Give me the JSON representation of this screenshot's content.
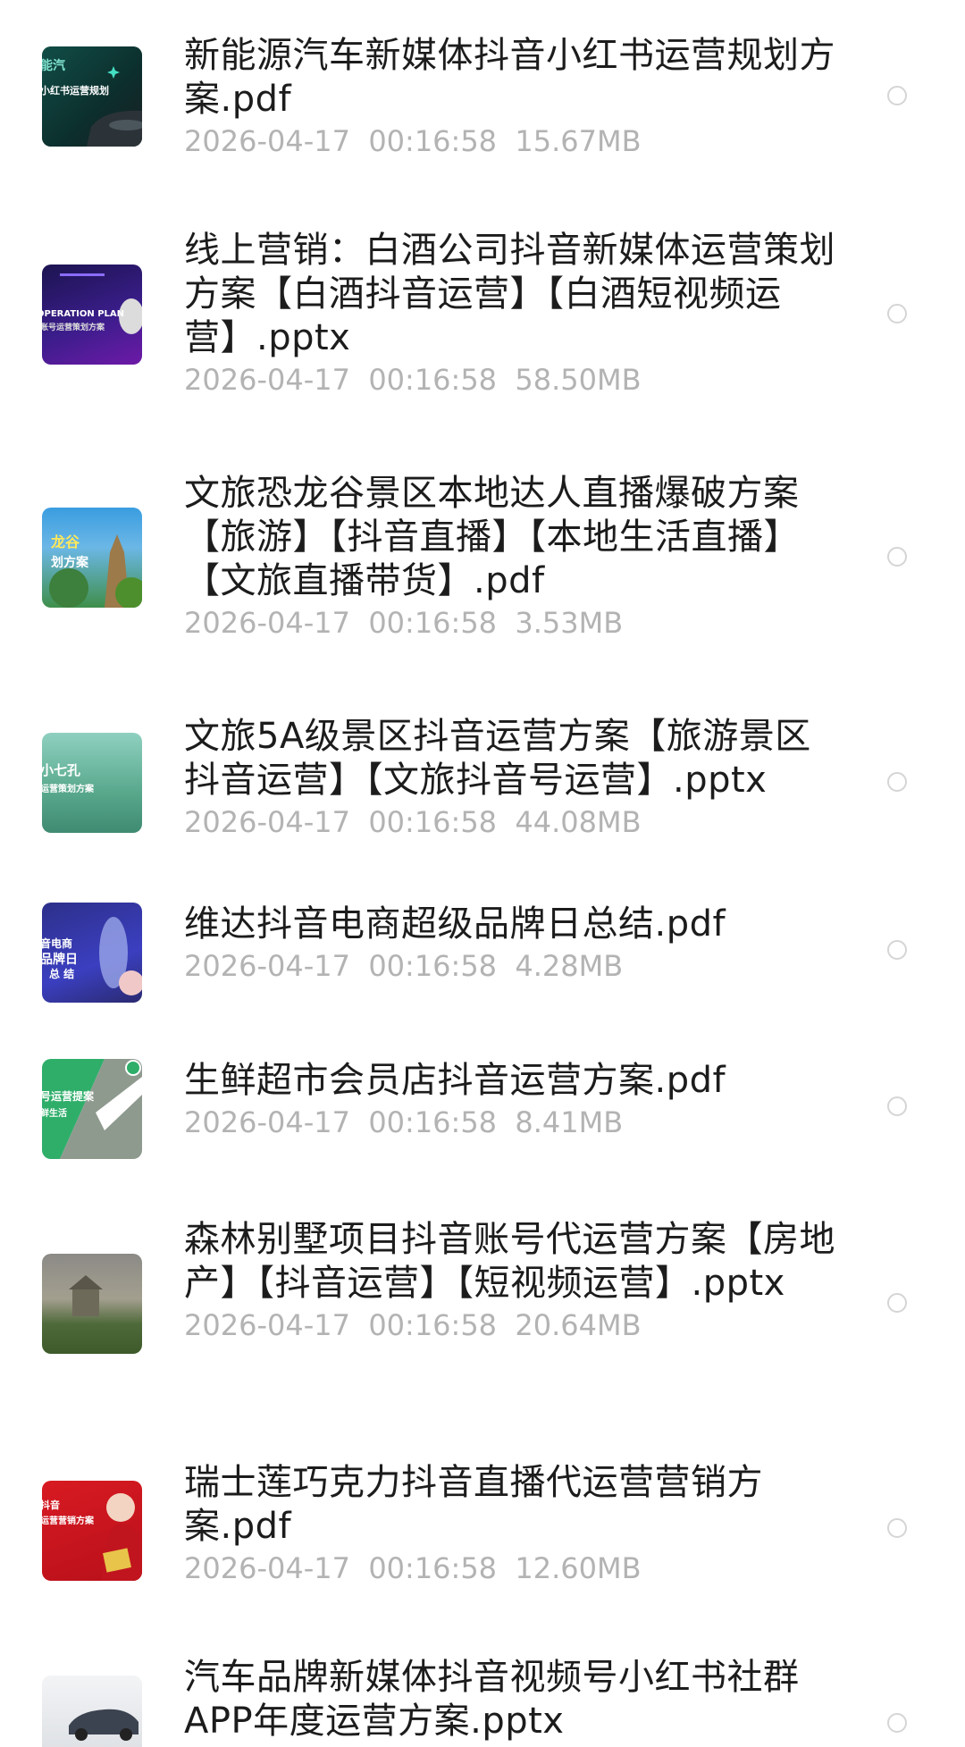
{
  "files": [
    {
      "name": "新能源汽车新媒体抖音小红书运营规划方案.pdf",
      "date": "2026-04-17",
      "time": "00:16:58",
      "size": "15.67MB",
      "thumb_text": [
        "能汽",
        "小红书运营规划"
      ],
      "thumb_bg": "#0f3b38"
    },
    {
      "name": "线上营销：白酒公司抖音新媒体运营策划方案【白酒抖音运营】【白酒短视频运营】.pptx",
      "date": "2026-04-17",
      "time": "00:16:58",
      "size": "58.50MB",
      "thumb_text": [
        "OPERATION PLAN",
        "账号运营策划方案"
      ],
      "thumb_bg": "#2a1a6e"
    },
    {
      "name": "文旅恐龙谷景区本地达人直播爆破方案【旅游】【抖音直播】【本地生活直播】【文旅直播带货】.pdf",
      "date": "2026-04-17",
      "time": "00:16:58",
      "size": "3.53MB",
      "thumb_text": [
        "龙谷",
        "划方案"
      ],
      "thumb_bg": "#2a8fd0"
    },
    {
      "name": "文旅5A级景区抖音运营方案【旅游景区抖音运营】【文旅抖音号运营】.pptx",
      "date": "2026-04-17",
      "time": "00:16:58",
      "size": "44.08MB",
      "thumb_text": [
        "小七孔",
        "运营策划方案"
      ],
      "thumb_bg": "#5fb39a"
    },
    {
      "name": "维达抖音电商超级品牌日总结.pdf",
      "date": "2026-04-17",
      "time": "00:16:58",
      "size": "4.28MB",
      "thumb_text": [
        "音电商",
        "品牌日",
        "总 结"
      ],
      "thumb_bg": "#3a3fb0"
    },
    {
      "name": "生鲜超市会员店抖音运营方案.pdf",
      "date": "2026-04-17",
      "time": "00:16:58",
      "size": "8.41MB",
      "thumb_text": [
        "号运营提案",
        "鲜生活"
      ],
      "thumb_bg": "#2fae6a"
    },
    {
      "name": "森林别墅项目抖音账号代运营方案【房地产】【抖音运营】【短视频运营】.pptx",
      "date": "2026-04-17",
      "time": "00:16:58",
      "size": "20.64MB",
      "thumb_text": [],
      "thumb_bg": "#7a7a6e"
    },
    {
      "name": "瑞士莲巧克力抖音直播代运营营销方案.pdf",
      "date": "2026-04-17",
      "time": "00:16:58",
      "size": "12.60MB",
      "thumb_text": [
        "抖音",
        "运营营销方案"
      ],
      "thumb_bg": "#c8141e"
    },
    {
      "name": "汽车品牌新媒体抖音视频号小红书社群APP年度运营方案.pptx",
      "date": "2026-04-17",
      "time": "00:16:58",
      "size": "",
      "thumb_text": [],
      "thumb_bg": "#e9ebee"
    }
  ]
}
